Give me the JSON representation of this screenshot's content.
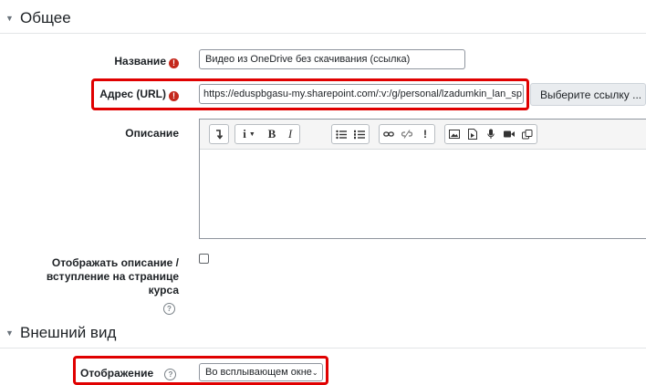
{
  "general": {
    "section_title": "Общее",
    "name_label": "Название",
    "name_value": "Видео из OneDrive без скачивания (ссылка)",
    "url_label": "Адрес (URL)",
    "url_value": "https://eduspbgasu-my.sharepoint.com/:v:/g/personal/lzadumkin_lan_sp",
    "choose_link_label": "Выберите ссылку ...",
    "description_label": "Описание",
    "show_description_label_line1": "Отображать описание /",
    "show_description_label_line2": "вступление на странице",
    "show_description_label_line3": "курса",
    "required_icon": "exclamation-circle-icon",
    "help_icon": "question-circle-icon"
  },
  "editor_toolbar": {
    "icons": [
      "collapse-icon",
      "info-style-icon",
      "bold-icon",
      "italic-icon",
      "unordered-list-icon",
      "ordered-list-icon",
      "link-icon",
      "unlink-icon",
      "emoji-icon",
      "image-icon",
      "media-icon",
      "record-audio-icon",
      "record-video-icon",
      "manage-files-icon"
    ],
    "bold_glyph": "B",
    "italic_glyph": "I",
    "info_glyph": "i"
  },
  "appearance": {
    "section_title": "Внешний вид",
    "display_label": "Отображение",
    "display_value": "Во всплывающем окне"
  },
  "colors": {
    "highlight": "#e00000",
    "required": "#c4281c"
  }
}
